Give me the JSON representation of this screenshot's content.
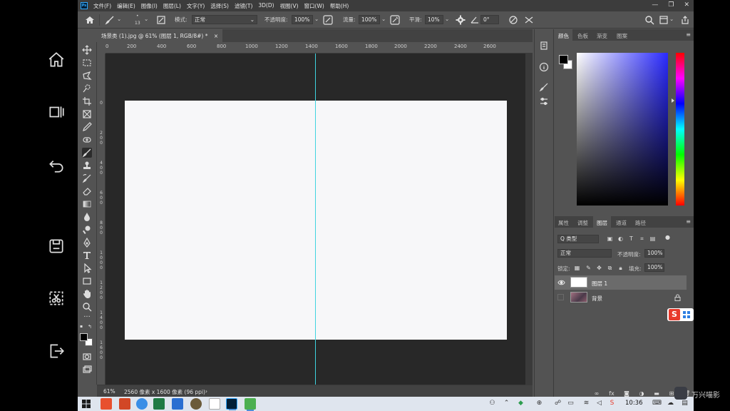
{
  "menubar": {
    "logo": "Ps",
    "menus": [
      "文件(F)",
      "编辑(E)",
      "图像(I)",
      "图层(L)",
      "文字(Y)",
      "选择(S)",
      "滤镜(T)",
      "3D(D)",
      "视图(V)",
      "窗口(W)",
      "帮助(H)"
    ]
  },
  "options": {
    "brush_size": "13",
    "mode_label": "模式:",
    "mode_value": "正常",
    "opacity_label": "不透明度:",
    "opacity_value": "100%",
    "flow_label": "流量:",
    "flow_value": "100%",
    "smooth_label": "平滑:",
    "smooth_value": "10%",
    "angle_value": "0°"
  },
  "document": {
    "tab_title": "场景类 (1).jpg @ 61% (图层 1, RGB/8#) *",
    "close": "×",
    "guide_color": "#3fd4e0",
    "canvas_color": "#f7f7f9"
  },
  "ruler_h_ticks": [
    "0",
    "200",
    "400",
    "600",
    "800",
    "1000",
    "1200",
    "1400",
    "1600",
    "1800",
    "2000",
    "2200",
    "2400",
    "2600"
  ],
  "ruler_v_ticks": [
    "0",
    "2 0 0",
    "4 0 0",
    "6 0 0",
    "8 0 0",
    "1 0 0 0",
    "1 2 0 0",
    "1 4 0 0",
    "1 6 0 0"
  ],
  "status": {
    "zoom": "61%",
    "info": "2560 像素 x 1600 像素 (96 ppi)",
    "arrow": "›"
  },
  "color_panel": {
    "tabs": [
      "颜色",
      "色板",
      "渐变",
      "图案"
    ],
    "active_tab": 0,
    "hue_colors": [
      "#ff0000",
      "#ff00ff",
      "#0000ff",
      "#00ffff",
      "#00ff00",
      "#ffff00",
      "#ff0000"
    ]
  },
  "layers_panel": {
    "tabs": [
      "属性",
      "调整",
      "图层",
      "通道",
      "路径"
    ],
    "active_tab": 2,
    "filter_label": "Q 类型",
    "blend_mode": "正常",
    "opacity_label": "不透明度:",
    "opacity_value": "100%",
    "lock_label": "锁定:",
    "fill_label": "填充:",
    "fill_value": "100%",
    "layers": [
      {
        "name": "图层 1",
        "selected": true,
        "visible": true,
        "thumb_color": "#ffffff"
      },
      {
        "name": "背景",
        "selected": false,
        "visible": false,
        "thumb_color": "#6b4a5a",
        "locked": true
      }
    ]
  },
  "taskbar": {
    "time": "10:36"
  },
  "watermark": {
    "text": "万兴喵影"
  }
}
